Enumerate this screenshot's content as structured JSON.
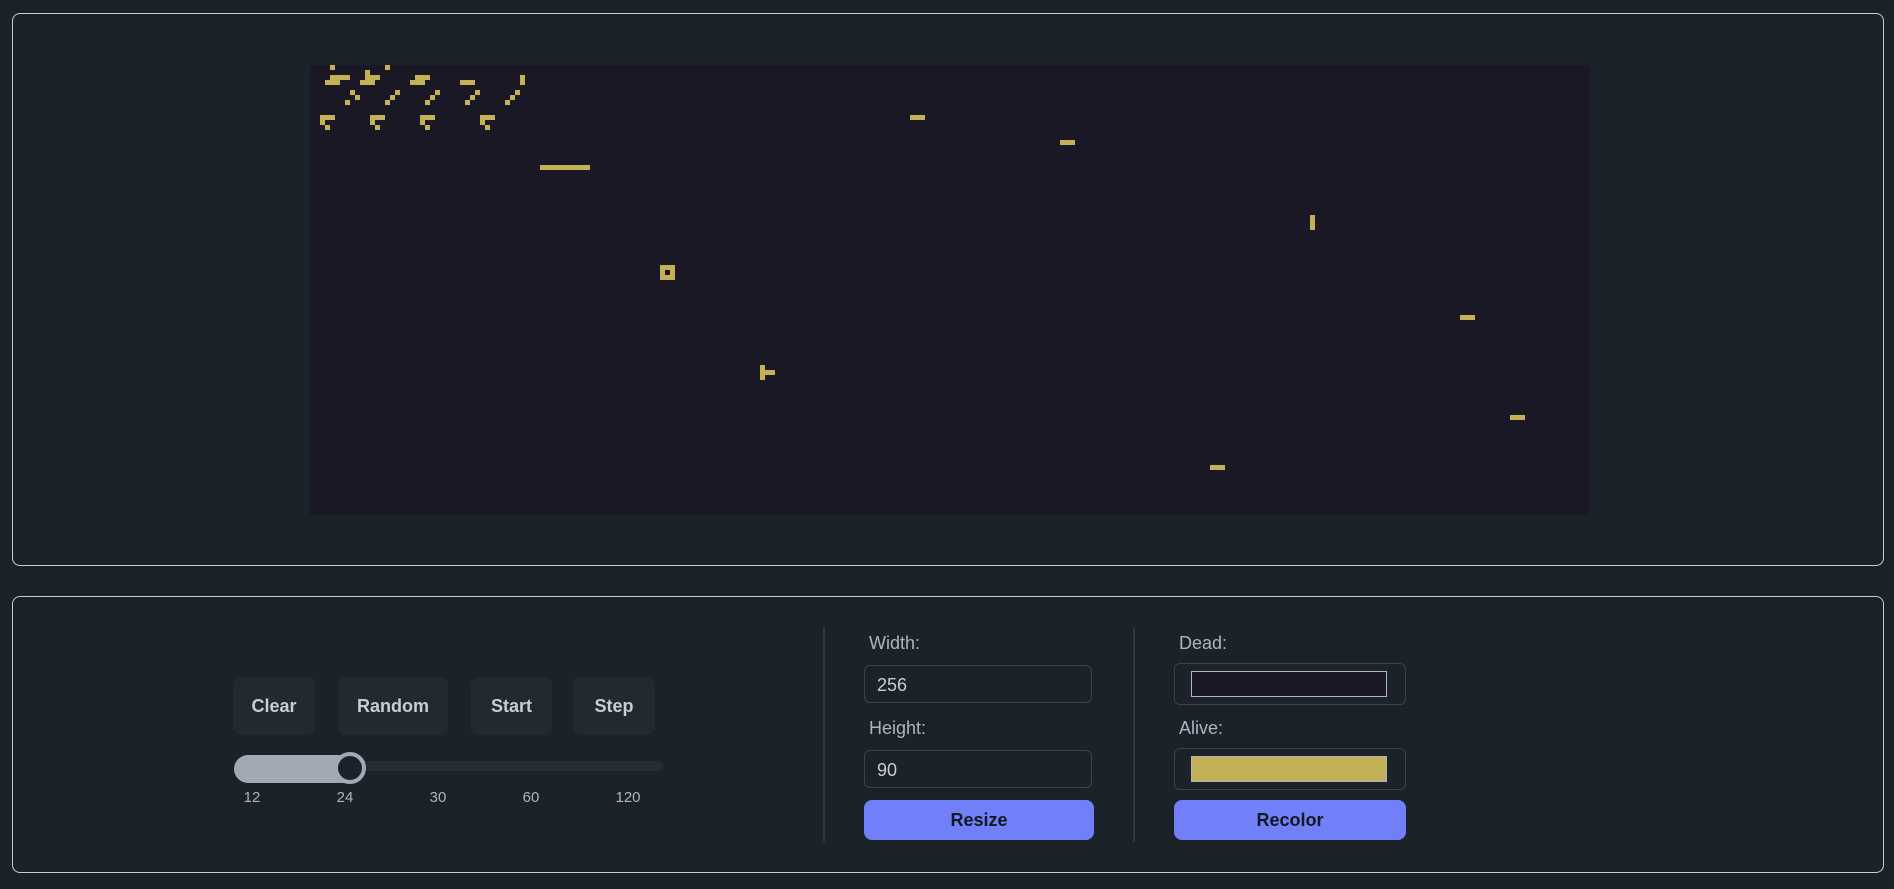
{
  "board": {
    "dead_color": "#1b1826",
    "alive_color": "#c4b155",
    "cells": [
      [
        4,
        0
      ],
      [
        15,
        0
      ],
      [
        11,
        1
      ],
      [
        4,
        2
      ],
      [
        5,
        2
      ],
      [
        6,
        2
      ],
      [
        7,
        2
      ],
      [
        11,
        2
      ],
      [
        12,
        2
      ],
      [
        13,
        2
      ],
      [
        21,
        2
      ],
      [
        22,
        2
      ],
      [
        23,
        2
      ],
      [
        42,
        2
      ],
      [
        3,
        3
      ],
      [
        4,
        3
      ],
      [
        5,
        3
      ],
      [
        10,
        3
      ],
      [
        11,
        3
      ],
      [
        12,
        3
      ],
      [
        20,
        3
      ],
      [
        21,
        3
      ],
      [
        22,
        3
      ],
      [
        30,
        3
      ],
      [
        31,
        3
      ],
      [
        32,
        3
      ],
      [
        42,
        3
      ],
      [
        8,
        5
      ],
      [
        17,
        5
      ],
      [
        25,
        5
      ],
      [
        33,
        5
      ],
      [
        41,
        5
      ],
      [
        9,
        6
      ],
      [
        16,
        6
      ],
      [
        24,
        6
      ],
      [
        32,
        6
      ],
      [
        40,
        6
      ],
      [
        7,
        7
      ],
      [
        15,
        7
      ],
      [
        23,
        7
      ],
      [
        31,
        7
      ],
      [
        39,
        7
      ],
      [
        2,
        10
      ],
      [
        3,
        10
      ],
      [
        4,
        10
      ],
      [
        12,
        10
      ],
      [
        13,
        10
      ],
      [
        14,
        10
      ],
      [
        22,
        10
      ],
      [
        23,
        10
      ],
      [
        24,
        10
      ],
      [
        34,
        10
      ],
      [
        35,
        10
      ],
      [
        36,
        10
      ],
      [
        2,
        11
      ],
      [
        12,
        11
      ],
      [
        22,
        11
      ],
      [
        34,
        11
      ],
      [
        3,
        12
      ],
      [
        13,
        12
      ],
      [
        23,
        12
      ],
      [
        35,
        12
      ],
      [
        46,
        20
      ],
      [
        47,
        20
      ],
      [
        48,
        20
      ],
      [
        49,
        20
      ],
      [
        50,
        20
      ],
      [
        51,
        20
      ],
      [
        52,
        20
      ],
      [
        53,
        20
      ],
      [
        54,
        20
      ],
      [
        55,
        20
      ],
      [
        70,
        40
      ],
      [
        71,
        40
      ],
      [
        72,
        40
      ],
      [
        70,
        41
      ],
      [
        72,
        41
      ],
      [
        70,
        42
      ],
      [
        71,
        42
      ],
      [
        72,
        42
      ],
      [
        90,
        60
      ],
      [
        90,
        61
      ],
      [
        90,
        62
      ],
      [
        91,
        61
      ],
      [
        92,
        61
      ],
      [
        120,
        10
      ],
      [
        121,
        10
      ],
      [
        122,
        10
      ],
      [
        150,
        15
      ],
      [
        151,
        15
      ],
      [
        152,
        15
      ],
      [
        200,
        30
      ],
      [
        200,
        31
      ],
      [
        200,
        32
      ],
      [
        230,
        50
      ],
      [
        231,
        50
      ],
      [
        232,
        50
      ],
      [
        240,
        70
      ],
      [
        241,
        70
      ],
      [
        242,
        70
      ],
      [
        180,
        80
      ],
      [
        181,
        80
      ],
      [
        182,
        80
      ]
    ]
  },
  "controls": {
    "buttons": {
      "clear": "Clear",
      "random": "Random",
      "start": "Start",
      "step": "Step"
    },
    "speed": {
      "ticks": [
        "12",
        "24",
        "30",
        "60",
        "120"
      ],
      "selected_index": 1,
      "fill_fraction": 0.27
    },
    "size": {
      "width_label": "Width:",
      "width_value": "256",
      "height_label": "Height:",
      "height_value": "90",
      "resize_label": "Resize"
    },
    "colors": {
      "dead_label": "Dead:",
      "dead_value": "#1b1826",
      "alive_label": "Alive:",
      "alive_value": "#c4b155",
      "recolor_label": "Recolor"
    }
  }
}
